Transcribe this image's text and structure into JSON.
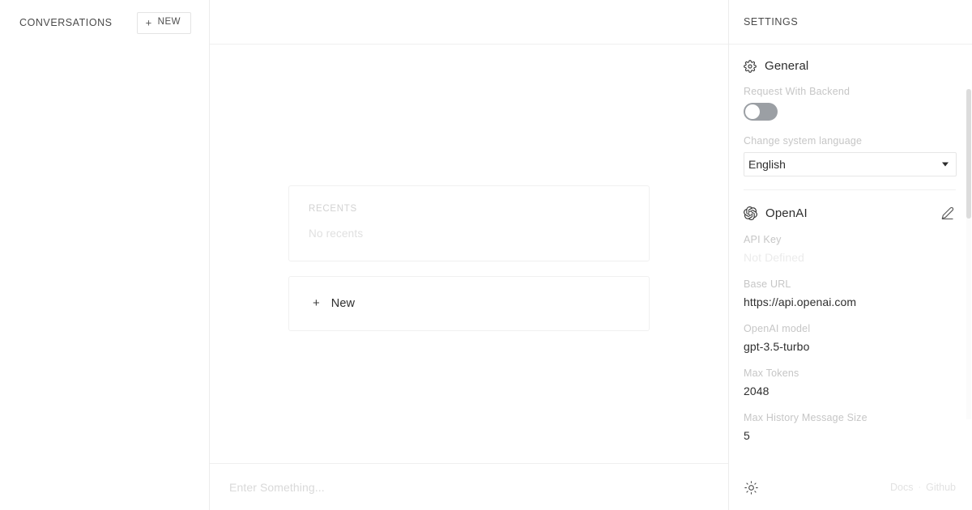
{
  "sidebar": {
    "title": "CONVERSATIONS",
    "new_button": {
      "label": "NEW",
      "plus": "+"
    }
  },
  "center": {
    "recents": {
      "label": "RECENTS",
      "empty_text": "No recents"
    },
    "new_chat": {
      "plus": "+",
      "label": "New"
    },
    "composer": {
      "placeholder": "Enter Something...",
      "value": ""
    }
  },
  "settings": {
    "title": "SETTINGS",
    "general": {
      "icon": "gear-icon",
      "title": "General",
      "request_with_backend": {
        "label": "Request With Backend",
        "state": "off"
      },
      "language": {
        "label": "Change system language",
        "selected": "English",
        "options": [
          "English"
        ]
      }
    },
    "openai": {
      "icon": "openai-logo-icon",
      "title": "OpenAI",
      "edit_icon": "pencil-icon",
      "fields": [
        {
          "label": "API Key",
          "value": "Not Defined",
          "muted": true
        },
        {
          "label": "Base URL",
          "value": "https://api.openai.com",
          "muted": false
        },
        {
          "label": "OpenAI model",
          "value": "gpt-3.5-turbo",
          "muted": false
        },
        {
          "label": "Max Tokens",
          "value": "2048",
          "muted": false
        },
        {
          "label": "Max History Message Size",
          "value": "5",
          "muted": false
        }
      ]
    },
    "footer": {
      "theme_icon": "sun-icon",
      "docs_label": "Docs",
      "separator": "·",
      "github_label": "Github"
    }
  },
  "colors": {
    "toggle_track": "#9b9fa4",
    "border": "#ececec",
    "text_primary": "#2d2d2d",
    "text_muted": "#c6c6c6",
    "text_faint": "#e0e0e0"
  }
}
